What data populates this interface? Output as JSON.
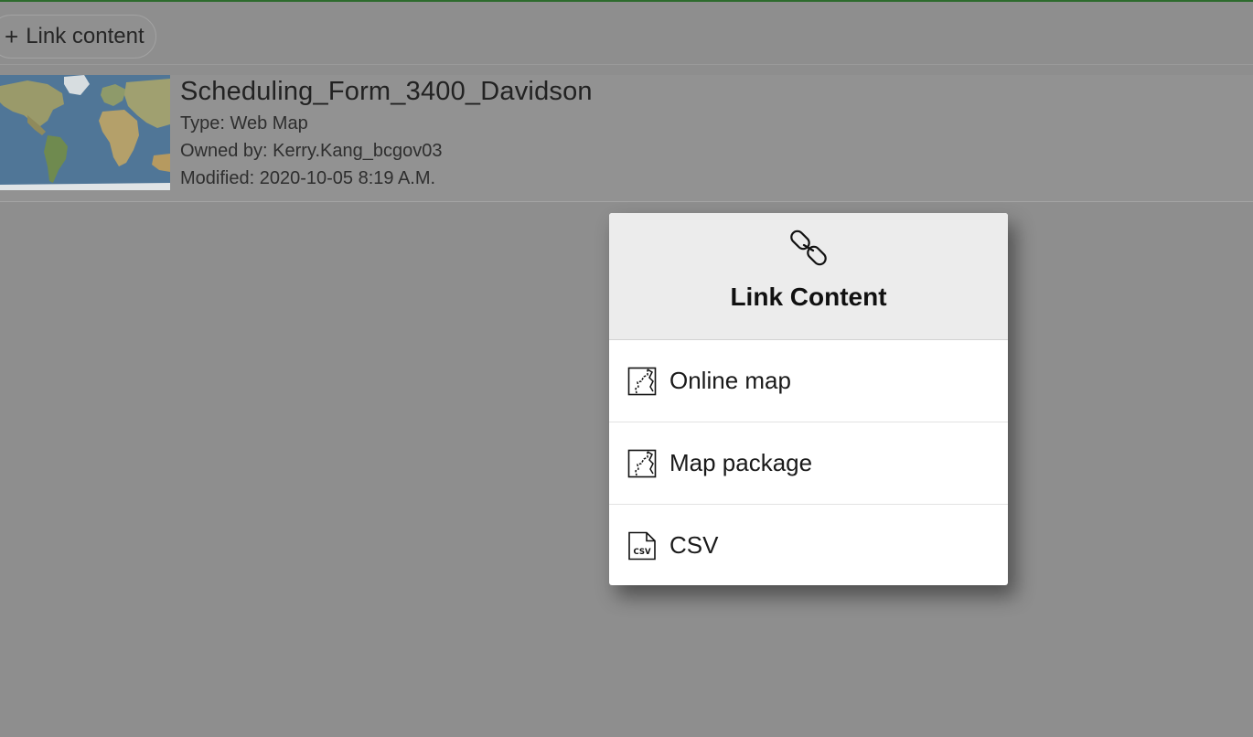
{
  "colors": {
    "backdrop": "#8e8e8e",
    "top_accent": "#2d6b2d",
    "dialog_bg": "#ffffff",
    "dialog_header_bg": "#ececec"
  },
  "toolbar": {
    "link_button_icon": "plus-icon",
    "link_button_label": "Link content"
  },
  "item": {
    "title": "Scheduling_Form_3400_Davidson",
    "type_line": "Type: Web Map",
    "owner_line": "Owned by: Kerry.Kang_bcgov03",
    "modified_line": "Modified: 2020-10-05 8:19 A.M.",
    "thumbnail_icon": "world-map-thumbnail"
  },
  "dialog": {
    "header_icon": "link-icon",
    "title": "Link Content",
    "options": [
      {
        "icon": "map-icon",
        "label": "Online map"
      },
      {
        "icon": "map-icon",
        "label": "Map package"
      },
      {
        "icon": "csv-file-icon",
        "label": "CSV"
      }
    ]
  }
}
